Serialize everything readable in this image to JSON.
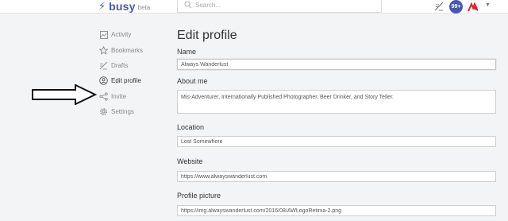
{
  "header": {
    "logo_word": "busy",
    "logo_badge": "beta",
    "search_placeholder": "Search...",
    "notification_count": "99+",
    "brand_color": "#4757b2"
  },
  "sidebar": {
    "items": [
      {
        "label": "Activity",
        "icon": "activity-icon"
      },
      {
        "label": "Bookmarks",
        "icon": "star-icon"
      },
      {
        "label": "Drafts",
        "icon": "drafts-icon"
      },
      {
        "label": "Edit profile",
        "icon": "user-icon",
        "active": true
      },
      {
        "label": "Invite",
        "icon": "share-icon"
      },
      {
        "label": "Settings",
        "icon": "gear-icon"
      }
    ]
  },
  "form": {
    "title": "Edit profile",
    "name_label": "Name",
    "name_value": "Always Wanderlust",
    "about_label": "About me",
    "about_value": "Mis-Adventurer, Internationally Published Photographer, Beer Drinker, and Story Teller.",
    "location_label": "Location",
    "location_value": "Lost Somewhere",
    "website_label": "Website",
    "website_value": "https://www.alwayswanderlust.com",
    "picture_label": "Profile picture",
    "picture_value": "https://img.alwayswanderlust.com/2016/08/AWLogoRetinia-2.png"
  }
}
